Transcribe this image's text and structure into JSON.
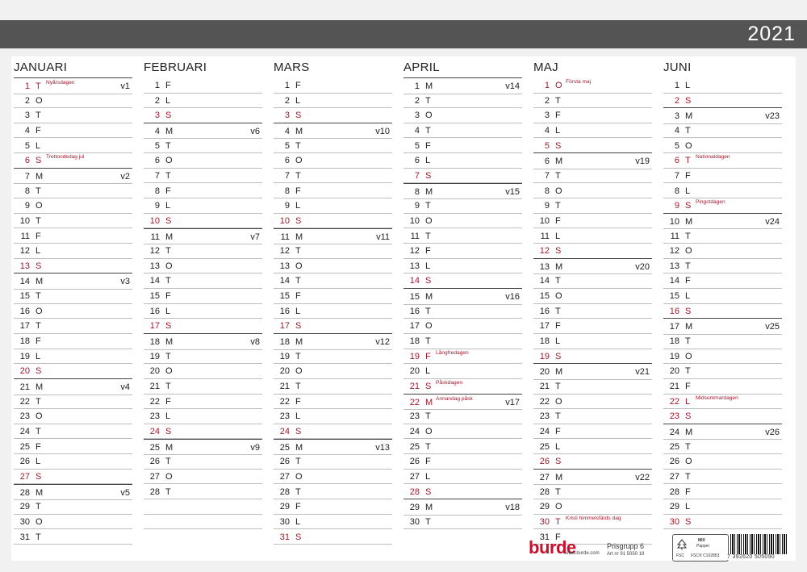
{
  "year": "2021",
  "colors": {
    "red": "#a31a2c",
    "bar": "#545454"
  },
  "months": [
    {
      "name": "JANUARI",
      "days": [
        {
          "d": "1",
          "l": "T",
          "r": true,
          "h": "Nyårsdagen",
          "w": "v1"
        },
        {
          "d": "2",
          "l": "O"
        },
        {
          "d": "3",
          "l": "T"
        },
        {
          "d": "4",
          "l": "F"
        },
        {
          "d": "5",
          "l": "L"
        },
        {
          "d": "6",
          "l": "S",
          "r": true,
          "h": "Trettondedag jul"
        },
        {
          "d": "7",
          "l": "M",
          "w": "v2"
        },
        {
          "d": "8",
          "l": "T"
        },
        {
          "d": "9",
          "l": "O"
        },
        {
          "d": "10",
          "l": "T"
        },
        {
          "d": "11",
          "l": "F"
        },
        {
          "d": "12",
          "l": "L"
        },
        {
          "d": "13",
          "l": "S",
          "r": true
        },
        {
          "d": "14",
          "l": "M",
          "w": "v3"
        },
        {
          "d": "15",
          "l": "T"
        },
        {
          "d": "16",
          "l": "O"
        },
        {
          "d": "17",
          "l": "T"
        },
        {
          "d": "18",
          "l": "F"
        },
        {
          "d": "19",
          "l": "L"
        },
        {
          "d": "20",
          "l": "S",
          "r": true
        },
        {
          "d": "21",
          "l": "M",
          "w": "v4"
        },
        {
          "d": "22",
          "l": "T"
        },
        {
          "d": "23",
          "l": "O"
        },
        {
          "d": "24",
          "l": "T"
        },
        {
          "d": "25",
          "l": "F"
        },
        {
          "d": "26",
          "l": "L"
        },
        {
          "d": "27",
          "l": "S",
          "r": true
        },
        {
          "d": "28",
          "l": "M",
          "w": "v5"
        },
        {
          "d": "29",
          "l": "T"
        },
        {
          "d": "30",
          "l": "O"
        },
        {
          "d": "31",
          "l": "T"
        }
      ]
    },
    {
      "name": "FEBRUARI",
      "days": [
        {
          "d": "1",
          "l": "F"
        },
        {
          "d": "2",
          "l": "L"
        },
        {
          "d": "3",
          "l": "S",
          "r": true
        },
        {
          "d": "4",
          "l": "M",
          "w": "v6"
        },
        {
          "d": "5",
          "l": "T"
        },
        {
          "d": "6",
          "l": "O"
        },
        {
          "d": "7",
          "l": "T"
        },
        {
          "d": "8",
          "l": "F"
        },
        {
          "d": "9",
          "l": "L"
        },
        {
          "d": "10",
          "l": "S",
          "r": true
        },
        {
          "d": "11",
          "l": "M",
          "w": "v7"
        },
        {
          "d": "12",
          "l": "T"
        },
        {
          "d": "13",
          "l": "O"
        },
        {
          "d": "14",
          "l": "T"
        },
        {
          "d": "15",
          "l": "F"
        },
        {
          "d": "16",
          "l": "L"
        },
        {
          "d": "17",
          "l": "S",
          "r": true
        },
        {
          "d": "18",
          "l": "M",
          "w": "v8"
        },
        {
          "d": "19",
          "l": "T"
        },
        {
          "d": "20",
          "l": "O"
        },
        {
          "d": "21",
          "l": "T"
        },
        {
          "d": "22",
          "l": "F"
        },
        {
          "d": "23",
          "l": "L"
        },
        {
          "d": "24",
          "l": "S",
          "r": true
        },
        {
          "d": "25",
          "l": "M",
          "w": "v9"
        },
        {
          "d": "26",
          "l": "T"
        },
        {
          "d": "27",
          "l": "O"
        },
        {
          "d": "28",
          "l": "T"
        },
        {
          "d": "",
          "l": ""
        },
        {
          "d": "",
          "l": ""
        }
      ]
    },
    {
      "name": "MARS",
      "days": [
        {
          "d": "1",
          "l": "F"
        },
        {
          "d": "2",
          "l": "L"
        },
        {
          "d": "3",
          "l": "S",
          "r": true
        },
        {
          "d": "4",
          "l": "M",
          "w": "v10"
        },
        {
          "d": "5",
          "l": "T"
        },
        {
          "d": "6",
          "l": "O"
        },
        {
          "d": "7",
          "l": "T"
        },
        {
          "d": "8",
          "l": "F"
        },
        {
          "d": "9",
          "l": "L"
        },
        {
          "d": "10",
          "l": "S",
          "r": true
        },
        {
          "d": "11",
          "l": "M",
          "w": "v11"
        },
        {
          "d": "12",
          "l": "T"
        },
        {
          "d": "13",
          "l": "O"
        },
        {
          "d": "14",
          "l": "T"
        },
        {
          "d": "15",
          "l": "F"
        },
        {
          "d": "16",
          "l": "L"
        },
        {
          "d": "17",
          "l": "S",
          "r": true
        },
        {
          "d": "18",
          "l": "M",
          "w": "v12"
        },
        {
          "d": "19",
          "l": "T"
        },
        {
          "d": "20",
          "l": "O"
        },
        {
          "d": "21",
          "l": "T"
        },
        {
          "d": "22",
          "l": "F"
        },
        {
          "d": "23",
          "l": "L"
        },
        {
          "d": "24",
          "l": "S",
          "r": true
        },
        {
          "d": "25",
          "l": "M",
          "w": "v13"
        },
        {
          "d": "26",
          "l": "T"
        },
        {
          "d": "27",
          "l": "O"
        },
        {
          "d": "28",
          "l": "T"
        },
        {
          "d": "29",
          "l": "F"
        },
        {
          "d": "30",
          "l": "L"
        },
        {
          "d": "31",
          "l": "S",
          "r": true
        }
      ]
    },
    {
      "name": "APRIL",
      "days": [
        {
          "d": "1",
          "l": "M",
          "w": "v14"
        },
        {
          "d": "2",
          "l": "T"
        },
        {
          "d": "3",
          "l": "O"
        },
        {
          "d": "4",
          "l": "T"
        },
        {
          "d": "5",
          "l": "F"
        },
        {
          "d": "6",
          "l": "L"
        },
        {
          "d": "7",
          "l": "S",
          "r": true
        },
        {
          "d": "8",
          "l": "M",
          "w": "v15"
        },
        {
          "d": "9",
          "l": "T"
        },
        {
          "d": "10",
          "l": "O"
        },
        {
          "d": "11",
          "l": "T"
        },
        {
          "d": "12",
          "l": "F"
        },
        {
          "d": "13",
          "l": "L"
        },
        {
          "d": "14",
          "l": "S",
          "r": true
        },
        {
          "d": "15",
          "l": "M",
          "w": "v16"
        },
        {
          "d": "16",
          "l": "T"
        },
        {
          "d": "17",
          "l": "O"
        },
        {
          "d": "18",
          "l": "T"
        },
        {
          "d": "19",
          "l": "F",
          "r": true,
          "h": "Långfredagen"
        },
        {
          "d": "20",
          "l": "L"
        },
        {
          "d": "21",
          "l": "S",
          "r": true,
          "h": "Påskdagen"
        },
        {
          "d": "22",
          "l": "M",
          "r": true,
          "h": "Annandag påsk",
          "w": "v17"
        },
        {
          "d": "23",
          "l": "T"
        },
        {
          "d": "24",
          "l": "O"
        },
        {
          "d": "25",
          "l": "T"
        },
        {
          "d": "26",
          "l": "F"
        },
        {
          "d": "27",
          "l": "L"
        },
        {
          "d": "28",
          "l": "S",
          "r": true
        },
        {
          "d": "29",
          "l": "M",
          "w": "v18"
        },
        {
          "d": "30",
          "l": "T"
        }
      ]
    },
    {
      "name": "MAJ",
      "days": [
        {
          "d": "1",
          "l": "O",
          "r": true,
          "h": "Första maj"
        },
        {
          "d": "2",
          "l": "T"
        },
        {
          "d": "3",
          "l": "F"
        },
        {
          "d": "4",
          "l": "L"
        },
        {
          "d": "5",
          "l": "S",
          "r": true
        },
        {
          "d": "6",
          "l": "M",
          "w": "v19"
        },
        {
          "d": "7",
          "l": "T"
        },
        {
          "d": "8",
          "l": "O"
        },
        {
          "d": "9",
          "l": "T"
        },
        {
          "d": "10",
          "l": "F"
        },
        {
          "d": "11",
          "l": "L"
        },
        {
          "d": "12",
          "l": "S",
          "r": true
        },
        {
          "d": "13",
          "l": "M",
          "w": "v20"
        },
        {
          "d": "14",
          "l": "T"
        },
        {
          "d": "15",
          "l": "O"
        },
        {
          "d": "16",
          "l": "T"
        },
        {
          "d": "17",
          "l": "F"
        },
        {
          "d": "18",
          "l": "L"
        },
        {
          "d": "19",
          "l": "S",
          "r": true
        },
        {
          "d": "20",
          "l": "M",
          "w": "v21"
        },
        {
          "d": "21",
          "l": "T"
        },
        {
          "d": "22",
          "l": "O"
        },
        {
          "d": "23",
          "l": "T"
        },
        {
          "d": "24",
          "l": "F"
        },
        {
          "d": "25",
          "l": "L"
        },
        {
          "d": "26",
          "l": "S",
          "r": true
        },
        {
          "d": "27",
          "l": "M",
          "w": "v22"
        },
        {
          "d": "28",
          "l": "T"
        },
        {
          "d": "29",
          "l": "O"
        },
        {
          "d": "30",
          "l": "T",
          "r": true,
          "h": "Kristi himmelsfärds dag"
        },
        {
          "d": "31",
          "l": "F"
        }
      ]
    },
    {
      "name": "JUNI",
      "days": [
        {
          "d": "1",
          "l": "L"
        },
        {
          "d": "2",
          "l": "S",
          "r": true
        },
        {
          "d": "3",
          "l": "M",
          "w": "v23"
        },
        {
          "d": "4",
          "l": "T"
        },
        {
          "d": "5",
          "l": "O"
        },
        {
          "d": "6",
          "l": "T",
          "r": true,
          "h": "Nationaldagen"
        },
        {
          "d": "7",
          "l": "F"
        },
        {
          "d": "8",
          "l": "L"
        },
        {
          "d": "9",
          "l": "S",
          "r": true,
          "h": "Pingstdagen"
        },
        {
          "d": "10",
          "l": "M",
          "w": "v24"
        },
        {
          "d": "11",
          "l": "T"
        },
        {
          "d": "12",
          "l": "O"
        },
        {
          "d": "13",
          "l": "T"
        },
        {
          "d": "14",
          "l": "F"
        },
        {
          "d": "15",
          "l": "L"
        },
        {
          "d": "16",
          "l": "S",
          "r": true
        },
        {
          "d": "17",
          "l": "M",
          "w": "v25"
        },
        {
          "d": "18",
          "l": "T"
        },
        {
          "d": "19",
          "l": "O"
        },
        {
          "d": "20",
          "l": "T"
        },
        {
          "d": "21",
          "l": "F"
        },
        {
          "d": "22",
          "l": "L",
          "r": true,
          "h": "Midsommardagen"
        },
        {
          "d": "23",
          "l": "S",
          "r": true
        },
        {
          "d": "24",
          "l": "M",
          "w": "v26"
        },
        {
          "d": "25",
          "l": "T"
        },
        {
          "d": "26",
          "l": "O"
        },
        {
          "d": "27",
          "l": "T"
        },
        {
          "d": "28",
          "l": "F"
        },
        {
          "d": "29",
          "l": "L"
        },
        {
          "d": "30",
          "l": "S",
          "r": true
        }
      ]
    }
  ],
  "footer": {
    "logo": "burde",
    "url": "www.burde.com",
    "price_group": "Prisgrupp 6",
    "article": "Art nr 91 5050 19",
    "fsc_mix": "MIX",
    "fsc_paper": "Papper",
    "fsc_code": "FSC® C102853",
    "fsc_label": "FSC",
    "barcode_number": "7 392620 505090"
  }
}
